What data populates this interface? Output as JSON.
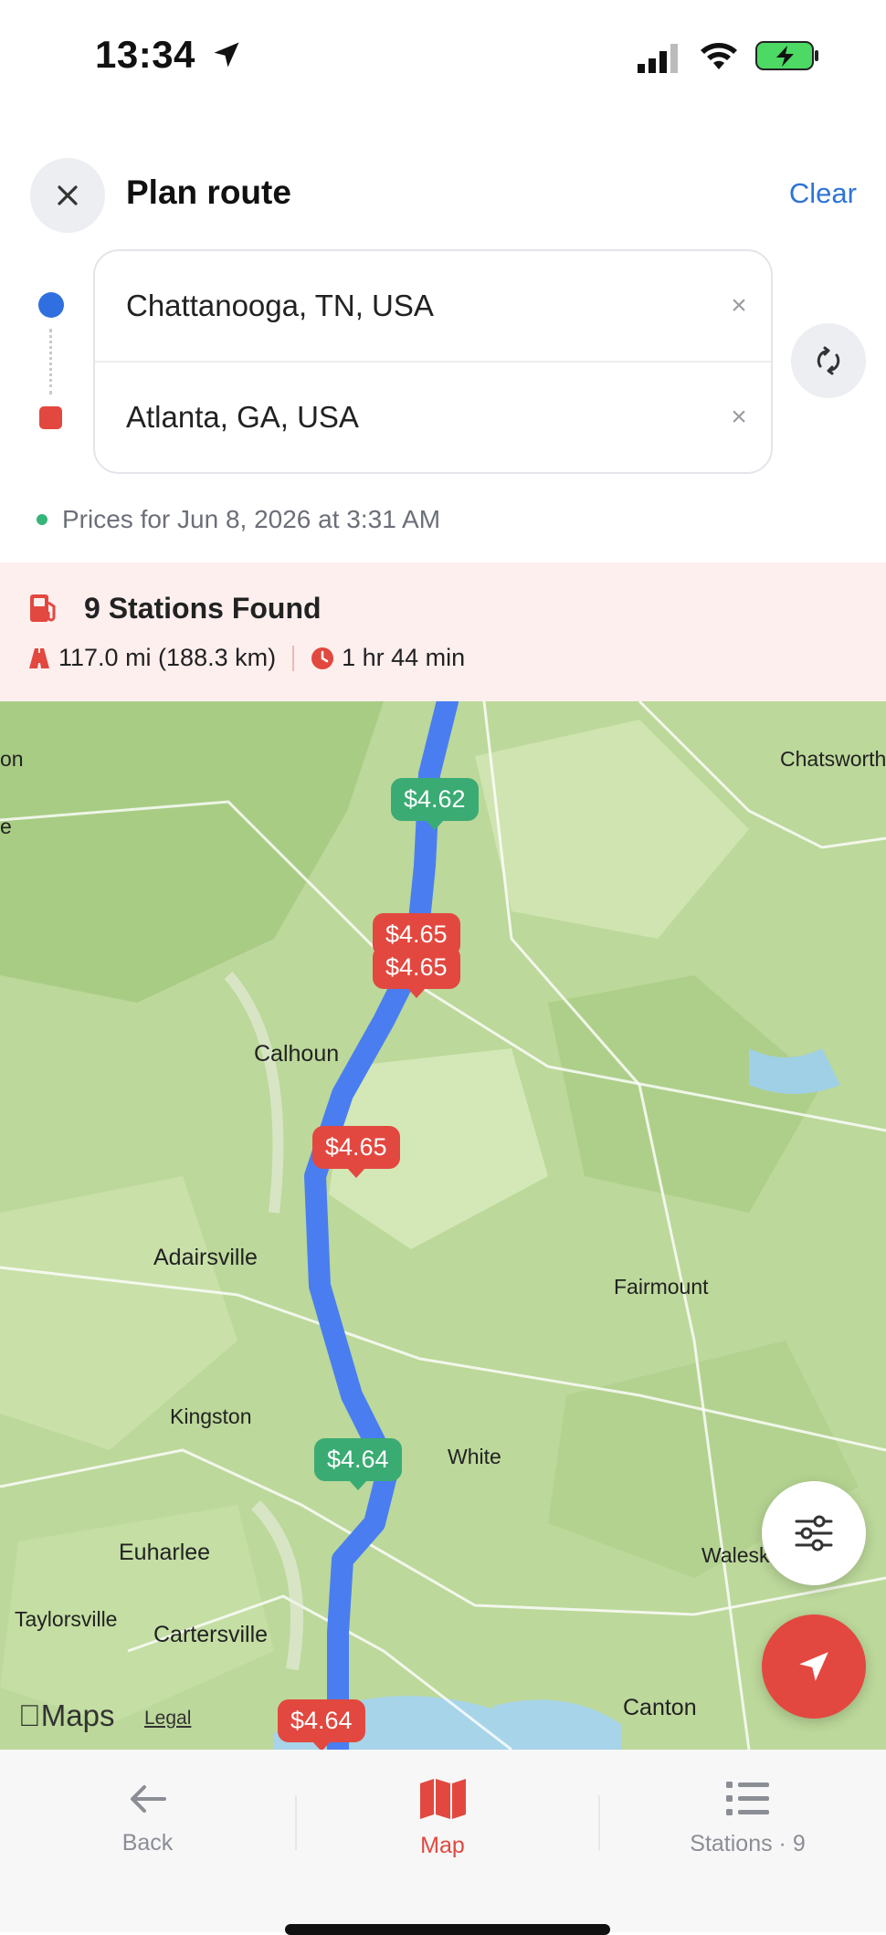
{
  "status_bar": {
    "time": "13:34"
  },
  "header": {
    "title": "Plan route",
    "clear_label": "Clear"
  },
  "route": {
    "origin": "Chattanooga, TN, USA",
    "destination": "Atlanta, GA, USA",
    "clear_symbol": "×"
  },
  "prices_note": "Prices for Jun 8, 2026 at 3:31 AM",
  "summary": {
    "title": "9 Stations Found",
    "distance": "117.0 mi (188.3 km)",
    "duration": "1 hr 44 min"
  },
  "map": {
    "price_pins": [
      {
        "price": "$4.62",
        "color": "green"
      },
      {
        "price": "$4.65",
        "color": "red"
      },
      {
        "price": "$4.65",
        "color": "red"
      },
      {
        "price": "$4.65",
        "color": "red"
      },
      {
        "price": "$4.64",
        "color": "green"
      },
      {
        "price": "$4.64",
        "color": "red"
      }
    ],
    "towns": [
      "Calhoun",
      "Adairsville",
      "Fairmount",
      "Kingston",
      "White",
      "Euharlee",
      "Waleska",
      "Taylorsville",
      "Cartersville",
      "Canton",
      "Chatsworth",
      "on",
      "e"
    ],
    "attribution": {
      "logo": "Maps",
      "legal": "Legal"
    }
  },
  "tabs": {
    "back": "Back",
    "map": "Map",
    "stations": "Stations · 9"
  },
  "colors": {
    "accent": "#e2483f",
    "link": "#2f74d6",
    "green": "#3aab73",
    "route": "#4a7ef0"
  }
}
